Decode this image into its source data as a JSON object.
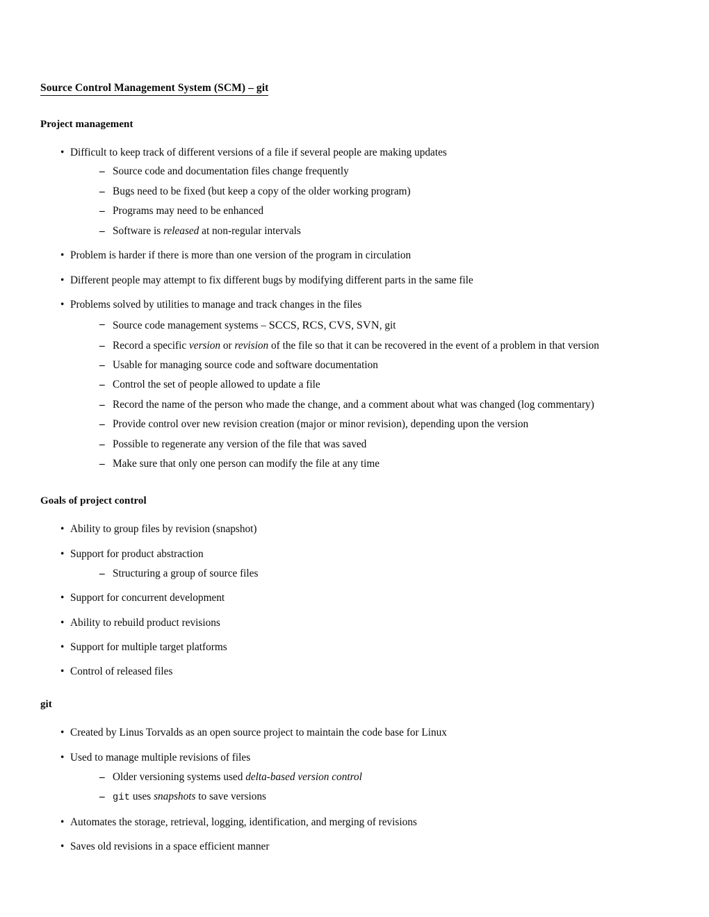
{
  "document": {
    "title": "Source Control Management System (SCM) – git"
  },
  "sections": {
    "project_management": {
      "heading": "Project management",
      "b1": {
        "text": "Difficult to keep track of different versions of a file if several people are making updates",
        "sub": {
          "s1": "Source code and documentation files change frequently",
          "s2": "Bugs need to be fixed (but keep a copy of the older working program)",
          "s3": "Programs may need to be enhanced",
          "s4_pre": "Software is ",
          "s4_em": "released",
          "s4_post": " at non-regular intervals"
        }
      },
      "b2": "Problem is harder if there is more than one version of the program in circulation",
      "b3": "Different people may attempt to fix different bugs by modifying different parts in the same file",
      "b4": "Problems solved by utilities to manage and track changes in the files",
      "b4_sub": {
        "s1_pre": "Source code management systems – ",
        "s1_sccs": "SCCS",
        "s1_sep1": ", ",
        "s1_rcs": "RCS",
        "s1_sep2": ", ",
        "s1_cvs": "CVS",
        "s1_sep3": ", ",
        "s1_svn": "SVN",
        "s1_post": ", git",
        "s2_pre": "Record a specific ",
        "s2_em1": "version",
        "s2_mid": " or ",
        "s2_em2": "revision",
        "s2_post": " of the file so that it can be recovered in the event of a problem in that version",
        "s3": "Usable for managing source code and software documentation",
        "s4": "Control the set of people allowed to update a file",
        "s5": "Record the name of the person who made the change, and a comment about what was changed (log commentary)",
        "s6": "Provide control over new revision creation (major or minor revision), depending upon the version",
        "s7": "Possible to regenerate any version of the file that was saved",
        "s8": "Make sure that only one person can modify the file at any time"
      }
    },
    "goals": {
      "heading": "Goals of project control",
      "b1": "Ability to group files by revision (snapshot)",
      "b2": "Support for product abstraction",
      "b2_sub": {
        "s1": "Structuring a group of source files"
      },
      "b3": "Support for concurrent development",
      "b4": "Ability to rebuild product revisions",
      "b5": "Support for multiple target platforms",
      "b6": "Control of released files"
    },
    "git": {
      "heading": "git",
      "b1": "Created by Linus Torvalds as an open source project to maintain the code base for Linux",
      "b2": "Used to manage multiple revisions of files",
      "b2_sub": {
        "s1_pre": "Older versioning systems used ",
        "s1_em": "delta-based version control",
        "s2_mono": "git",
        "s2_mid": " uses ",
        "s2_em": "snapshots",
        "s2_post": " to save versions"
      },
      "b3": "Automates the storage, retrieval, logging, identification, and merging of revisions",
      "b4": "Saves old revisions in a space efficient manner"
    }
  },
  "glyphs": {
    "bullet": "•",
    "dash": "–"
  }
}
